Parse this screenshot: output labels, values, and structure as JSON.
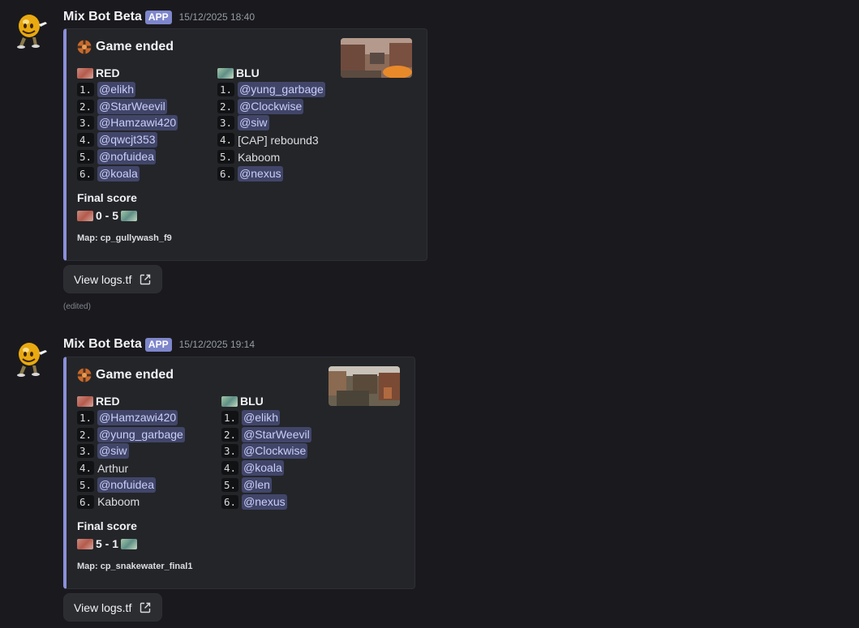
{
  "messages": [
    {
      "username": "Mix Bot Beta",
      "badge": "APP",
      "timestamp": "15/12/2025 18:40",
      "embed": {
        "title": "Game ended",
        "red": {
          "label": "RED",
          "players": [
            {
              "n": "1.",
              "name": "@elikh",
              "mention": true
            },
            {
              "n": "2.",
              "name": "@StarWeevil",
              "mention": true
            },
            {
              "n": "3.",
              "name": "@Hamzawi420",
              "mention": true
            },
            {
              "n": "4.",
              "name": "@qwcjt353",
              "mention": true
            },
            {
              "n": "5.",
              "name": "@nofuidea",
              "mention": true
            },
            {
              "n": "6.",
              "name": "@koala",
              "mention": true
            }
          ]
        },
        "blu": {
          "label": "BLU",
          "players": [
            {
              "n": "1.",
              "name": "@yung_garbage",
              "mention": true
            },
            {
              "n": "2.",
              "name": "@Clockwise",
              "mention": true
            },
            {
              "n": "3.",
              "name": "@siw",
              "mention": true
            },
            {
              "n": "4.",
              "name": "[CAP] rebound3",
              "mention": false
            },
            {
              "n": "5.",
              "name": "Kaboom",
              "mention": false
            },
            {
              "n": "6.",
              "name": "@nexus",
              "mention": true
            }
          ]
        },
        "score_label": "Final score",
        "score": "0 - 5",
        "map": "Map: cp_gullywash_f9"
      },
      "button": "View logs.tf",
      "edited": "(edited)"
    },
    {
      "username": "Mix Bot Beta",
      "badge": "APP",
      "timestamp": "15/12/2025 19:14",
      "embed": {
        "title": "Game ended",
        "red": {
          "label": "RED",
          "players": [
            {
              "n": "1.",
              "name": "@Hamzawi420",
              "mention": true
            },
            {
              "n": "2.",
              "name": "@yung_garbage",
              "mention": true
            },
            {
              "n": "3.",
              "name": "@siw",
              "mention": true
            },
            {
              "n": "4.",
              "name": "Arthur",
              "mention": false
            },
            {
              "n": "5.",
              "name": "@nofuidea",
              "mention": true
            },
            {
              "n": "6.",
              "name": "Kaboom",
              "mention": false
            }
          ]
        },
        "blu": {
          "label": "BLU",
          "players": [
            {
              "n": "1.",
              "name": "@elikh",
              "mention": true
            },
            {
              "n": "2.",
              "name": "@StarWeevil",
              "mention": true
            },
            {
              "n": "3.",
              "name": "@Clockwise",
              "mention": true
            },
            {
              "n": "4.",
              "name": "@koala",
              "mention": true
            },
            {
              "n": "5.",
              "name": "@len",
              "mention": true
            },
            {
              "n": "6.",
              "name": "@nexus",
              "mention": true
            }
          ]
        },
        "score_label": "Final score",
        "score": "5 - 1",
        "map": "Map: cp_snakewater_final1"
      },
      "button": "View logs.tf"
    }
  ],
  "colors": {
    "background": "#1a1a1e",
    "embed_bg": "#242529",
    "embed_accent": "#8a8fd9",
    "mention_bg": "#414669",
    "mention_text": "#c9cdfb",
    "badge_bg": "#7e86cc"
  },
  "icons": {
    "avatar": "smiley-bot-avatar",
    "title": "tf2-logo-icon",
    "red_team": "red-team-flag-icon",
    "blu_team": "blu-team-flag-icon",
    "external_link": "external-link-icon"
  }
}
